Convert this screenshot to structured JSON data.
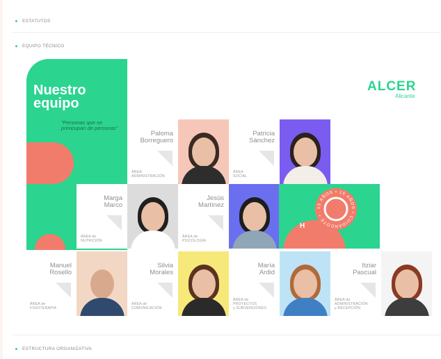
{
  "sections": {
    "estatutos": "ESTATUTOS",
    "equipo_tecnico": "EQUIPO TÉCNICO",
    "estructura": "ESTRUCTURA ORGANIZATIVA"
  },
  "panel": {
    "title": "Nuestro equipo",
    "quote": "\"Personas que se preocupan de personas\""
  },
  "logo": {
    "name": "ALCER",
    "city": "Alicante"
  },
  "stamp": {
    "text": "15 AÑOS • 15 AÑOS • CUIDÁNDOTE •"
  },
  "members": [
    {
      "name": "Paloma\nBorreguero",
      "area": "ÁREA\nADMINISTRACIÓN"
    },
    {
      "name": "Patricia\nSánchez",
      "area": "ÁREA\nSOCIAL"
    },
    {
      "name": "Marga\nMarco",
      "area": "ÁREA de\nNUTRICIÓN"
    },
    {
      "name": "Jesús\nMartínez",
      "area": "ÁREA de\nPSICOLOGÍA"
    },
    {
      "name": "Manuel\nRosello",
      "area": "ÁREA de\nFISIOTERAPIA"
    },
    {
      "name": "Silvia\nMorales",
      "area": "ÁREA de\nCOMUNICACIÓN"
    },
    {
      "name": "María\nArdid",
      "area": "ÁREA de\nPROYECTOS\ny SUBVENCIONES"
    },
    {
      "name": "Itziar\nPascual",
      "area": "ÁREA de\nADMINISTRACIÓN\ny RECEPCIÓN"
    }
  ],
  "colors": {
    "green": "#2bd48f",
    "coral": "#f27c6b",
    "accent_dot": "#3fcf9a"
  }
}
